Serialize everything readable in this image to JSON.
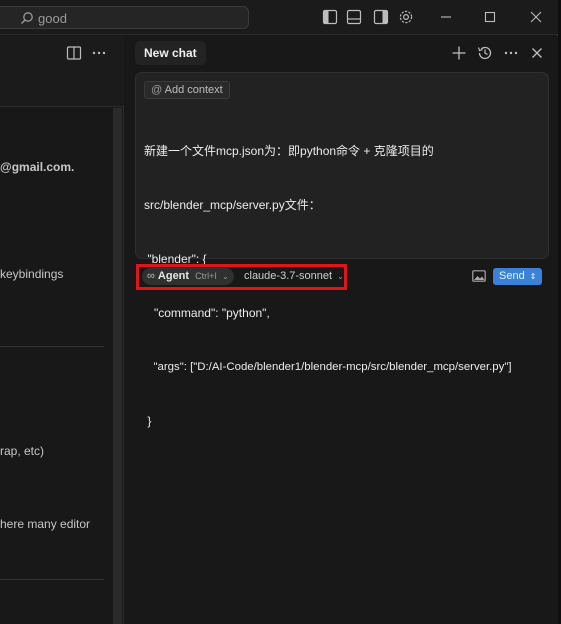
{
  "titlebar": {
    "search_text": "good"
  },
  "left_pane": {
    "fragments": [
      "@gmail.com.",
      "keybindings",
      "rap, etc)",
      "here many editor"
    ]
  },
  "chat": {
    "tab_label": "New chat",
    "add_context_label": "Add context",
    "message_lines": [
      "新建一个文件mcp.json为：即python命令 + 克隆项目的",
      "src/blender_mcp/server.py文件：",
      " \"blender\": {",
      "   \"command\": \"python\",",
      "   \"args\": [\"D:/AI-Code/blender1/blender-mcp/src/blender_mcp/server.py\"]",
      " }"
    ],
    "mode_label": "Agent",
    "mode_shortcut": "Ctrl+I",
    "model_label": "claude-3.7-sonnet",
    "send_label": "Send"
  },
  "colors": {
    "accent": "#3b82d6",
    "highlight": "#e0141c"
  }
}
